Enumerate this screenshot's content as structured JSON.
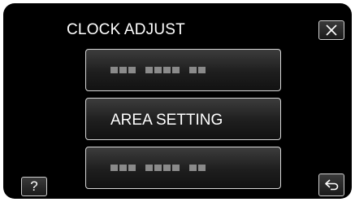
{
  "header": {
    "title": "CLOCK ADJUST"
  },
  "menu": {
    "items": [
      {
        "label": "",
        "obscured": true
      },
      {
        "label": "AREA SETTING",
        "obscured": false
      },
      {
        "label": "",
        "obscured": true
      }
    ]
  },
  "controls": {
    "help_label": "?",
    "close_icon": "close-icon",
    "back_icon": "return-arrow-icon"
  },
  "colors": {
    "background": "#000000",
    "text": "#ffffff",
    "button_border": "#d6d6d6",
    "placeholder_block": "#8a8a8a"
  }
}
